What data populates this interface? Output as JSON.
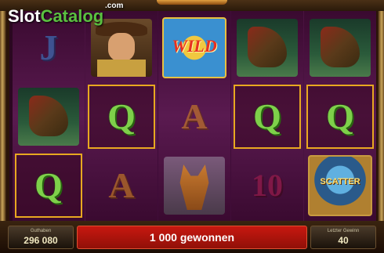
{
  "logo": {
    "text_main": "Slot",
    "text_accent": "Catalog",
    "suffix": ".com"
  },
  "reels": {
    "cells": [
      {
        "kind": "letter",
        "text": "J",
        "style": "j",
        "dim": true
      },
      {
        "kind": "croc",
        "icon": "crocodile-icon"
      },
      {
        "kind": "letter",
        "text": "Q",
        "style": "q",
        "win": true
      },
      {
        "kind": "ranger",
        "icon": "ranger-icon"
      },
      {
        "kind": "letter",
        "text": "Q",
        "style": "q",
        "win": true
      },
      {
        "kind": "letter",
        "text": "A",
        "style": "a",
        "dim": true
      },
      {
        "kind": "wild",
        "text": "WILD"
      },
      {
        "kind": "letter",
        "text": "A",
        "style": "a",
        "dim": true
      },
      {
        "kind": "dingo",
        "icon": "dingo-icon"
      },
      {
        "kind": "croc",
        "icon": "crocodile-icon"
      },
      {
        "kind": "letter",
        "text": "Q",
        "style": "q",
        "win": true
      },
      {
        "kind": "letter",
        "text": "10",
        "style": "10",
        "dim": true
      },
      {
        "kind": "croc",
        "icon": "crocodile-icon"
      },
      {
        "kind": "letter",
        "text": "Q",
        "style": "q",
        "win": true
      },
      {
        "kind": "scatter",
        "text": "SCATTER"
      }
    ]
  },
  "bottom": {
    "balance_label": "Guthaben",
    "balance_value": "296 080",
    "win_message": "1 000 gewonnen",
    "last_win_label": "Letzter Gewinn",
    "last_win_value": "40"
  }
}
